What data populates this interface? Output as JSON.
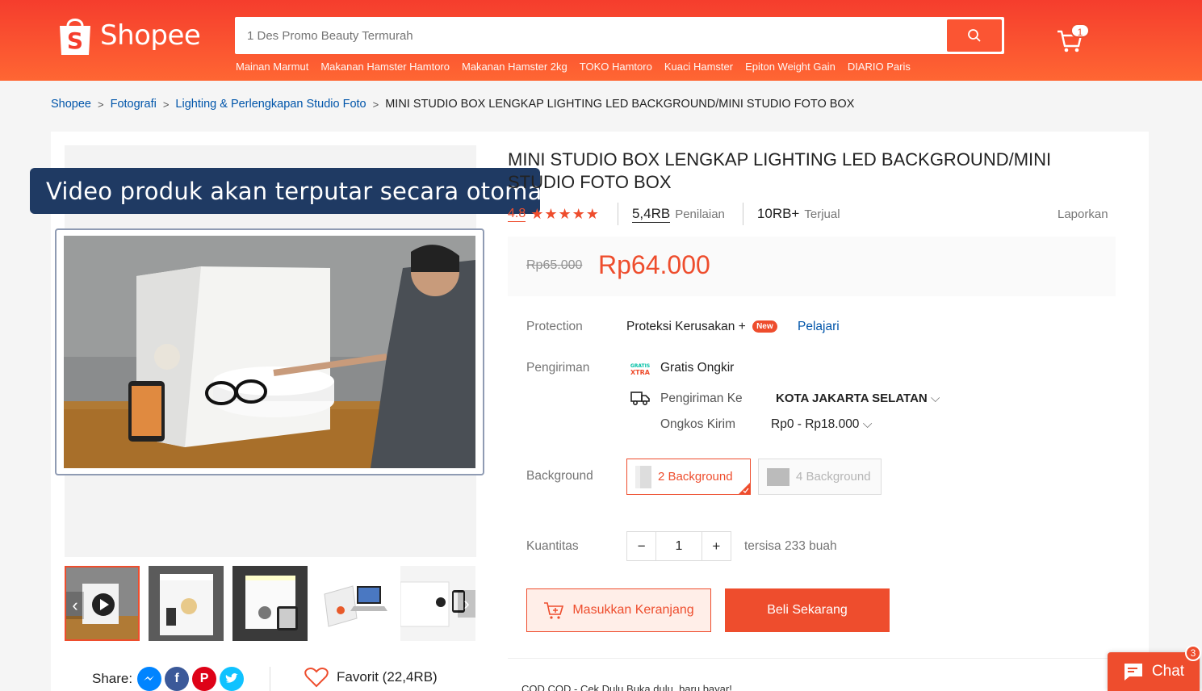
{
  "header": {
    "logo_text": "Shopee",
    "search_placeholder": "1 Des Promo Beauty Termurah",
    "suggestions": [
      "Mainan Marmut",
      "Makanan Hamster Hamtoro",
      "Makanan Hamster 2kg",
      "TOKO Hamtoro",
      "Kuaci Hamster",
      "Epiton Weight Gain",
      "DIARIO Paris"
    ],
    "cart_count": "1"
  },
  "breadcrumb": {
    "items": [
      "Shopee",
      "Fotografi",
      "Lighting & Perlengkapan Studio Foto"
    ],
    "current": "MINI STUDIO BOX LENGKAP LIGHTING LED BACKGROUND/MINI STUDIO FOTO BOX"
  },
  "media": {
    "tooltip": "Video produk akan terputar secara otomatis",
    "share_label": "Share:",
    "favorite_label": "Favorit (22,4RB)"
  },
  "product": {
    "title": "MINI STUDIO BOX LENGKAP LIGHTING LED BACKGROUND/MINI STUDIO FOTO BOX",
    "rating": "4.8",
    "stars": "★★★★★",
    "reviews_count": "5,4RB",
    "reviews_label": "Penilaian",
    "sold_count": "10RB+",
    "sold_label": "Terjual",
    "report": "Laporkan",
    "old_price": "Rp65.000",
    "price": "Rp64.000"
  },
  "details": {
    "protection_label": "Protection",
    "protection_value": "Proteksi Kerusakan +",
    "new_badge": "New",
    "learn_link": "Pelajari",
    "shipping_label": "Pengiriman",
    "free_shipping": "Gratis Ongkir",
    "ship_to_label": "Pengiriman Ke",
    "ship_to_value": "KOTA JAKARTA SELATAN",
    "ship_cost_label": "Ongkos Kirim",
    "ship_cost_value": "Rp0 - Rp18.000",
    "background_label": "Background",
    "variants": [
      "2 Background",
      "4 Background"
    ],
    "quantity_label": "Kuantitas",
    "quantity_value": "1",
    "stock": "tersisa 233 buah"
  },
  "actions": {
    "add_to_cart": "Masukkan Keranjang",
    "buy_now": "Beli Sekarang"
  },
  "footer": {
    "cod_text": "COD   COD - Cek Dulu     Bukа dulu, baru bayar!",
    "chat_label": "Chat",
    "chat_badge": "3"
  },
  "colors": {
    "brand": "#ee4d2d",
    "link": "#0055aa"
  }
}
